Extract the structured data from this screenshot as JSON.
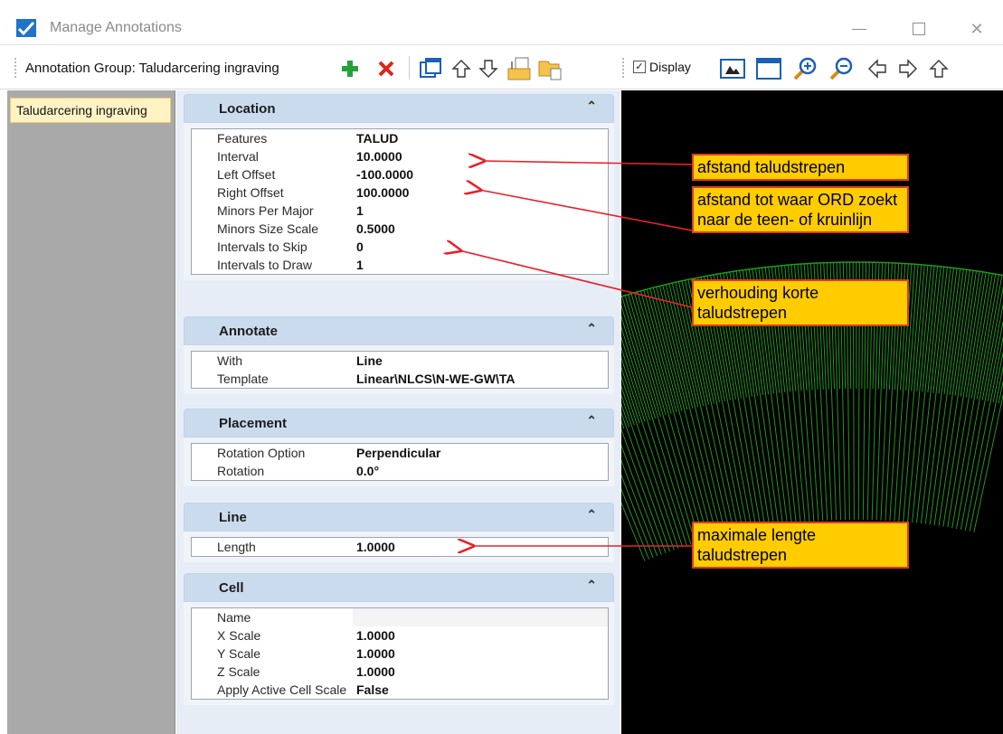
{
  "window": {
    "title": "Manage Annotations"
  },
  "toolbar": {
    "group_label": "Annotation Group: Taludarcering ingraving",
    "display_label": "Display",
    "display_checked": true,
    "icons": [
      "add-icon",
      "delete-icon",
      "move-group-icon",
      "arrow-up-icon",
      "arrow-down-icon",
      "export-icon",
      "import-icon",
      "display-checkbox",
      "view-icon",
      "window-icon",
      "zoom-in-icon",
      "zoom-out-icon",
      "arrow-left-icon",
      "arrow-right-icon",
      "arrow-up-nav-icon"
    ]
  },
  "tree": {
    "items": [
      {
        "label": "Taludarcering ingraving",
        "selected": true
      }
    ]
  },
  "sections": {
    "location": {
      "title": "Location",
      "rows": [
        {
          "key": "Features",
          "value": "TALUD"
        },
        {
          "key": "Interval",
          "value": "10.0000"
        },
        {
          "key": "Left Offset",
          "value": "-100.0000"
        },
        {
          "key": "Right Offset",
          "value": "100.0000"
        },
        {
          "key": "Minors Per Major",
          "value": "1"
        },
        {
          "key": "Minors Size Scale",
          "value": "0.5000"
        },
        {
          "key": "Intervals to Skip",
          "value": "0"
        },
        {
          "key": "Intervals to Draw",
          "value": "1"
        }
      ]
    },
    "annotate": {
      "title": "Annotate",
      "rows": [
        {
          "key": "With",
          "value": "Line"
        },
        {
          "key": "Template",
          "value": "Linear\\NLCS\\N-WE-GW\\TA"
        }
      ]
    },
    "placement": {
      "title": "Placement",
      "rows": [
        {
          "key": "Rotation Option",
          "value": "Perpendicular"
        },
        {
          "key": "Rotation",
          "value": "0.0°"
        }
      ]
    },
    "line": {
      "title": "Line",
      "rows": [
        {
          "key": "Length",
          "value": "1.0000"
        }
      ]
    },
    "cell": {
      "title": "Cell",
      "rows": [
        {
          "key": "Name",
          "value": ""
        },
        {
          "key": "X Scale",
          "value": "1.0000"
        },
        {
          "key": "Y Scale",
          "value": "1.0000"
        },
        {
          "key": "Z Scale",
          "value": "1.0000"
        },
        {
          "key": "Apply Active Cell Scale",
          "value": "False"
        }
      ]
    }
  },
  "callouts": {
    "interval": "afstand taludstrepen",
    "offset": "afstand tot waar ORD zoekt naar de teen- of kruinlijn",
    "scale": "verhouding korte taludstrepen",
    "length": "maximale lengte taludstrepen"
  },
  "colors": {
    "callout_fill": "#ffcc00",
    "callout_border": "#e03a25",
    "arrow": "#e8202a",
    "hatch": "#1f9a1f",
    "view_bg": "#000000",
    "section_header": "#cbdbee"
  }
}
